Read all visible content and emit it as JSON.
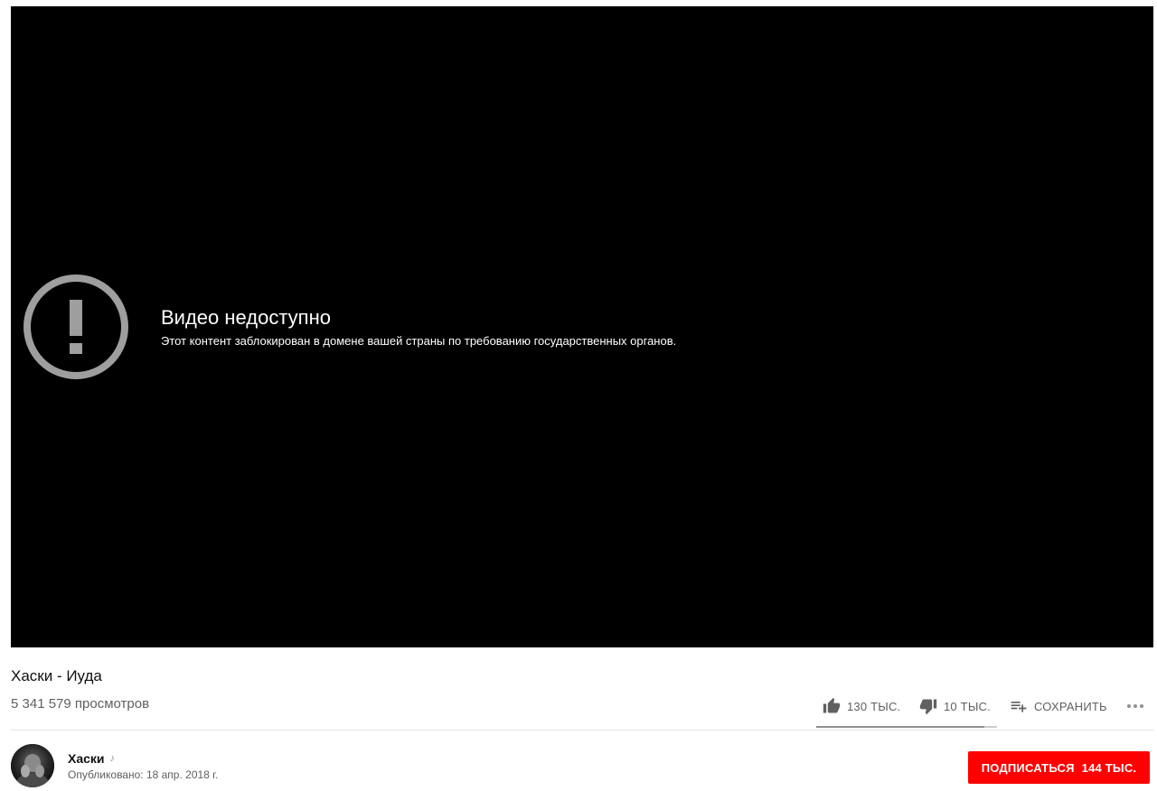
{
  "player": {
    "error_title": "Видео недоступно",
    "error_message": "Этот контент заблокирован в домене вашей страны по требованию государственных органов.",
    "error_icon": "alert-circle-icon",
    "background_color": "#000000",
    "icon_color": "#9e9e9e"
  },
  "video": {
    "title": "Хаски - Иуда",
    "views": "5 341 579 просмотров"
  },
  "actions": {
    "likes": "130 ТЫС.",
    "dislikes": "10 ТЫС.",
    "save_label": "СОХРАНИТЬ",
    "like_ratio": 0.93
  },
  "channel": {
    "name": "Хаски",
    "music_icon": "music-note-icon",
    "published": "Опубликовано: 18 апр. 2018 г."
  },
  "subscribe": {
    "label": "ПОДПИСАТЬСЯ",
    "count": "144 ТЫС.",
    "color": "#ff0000"
  }
}
